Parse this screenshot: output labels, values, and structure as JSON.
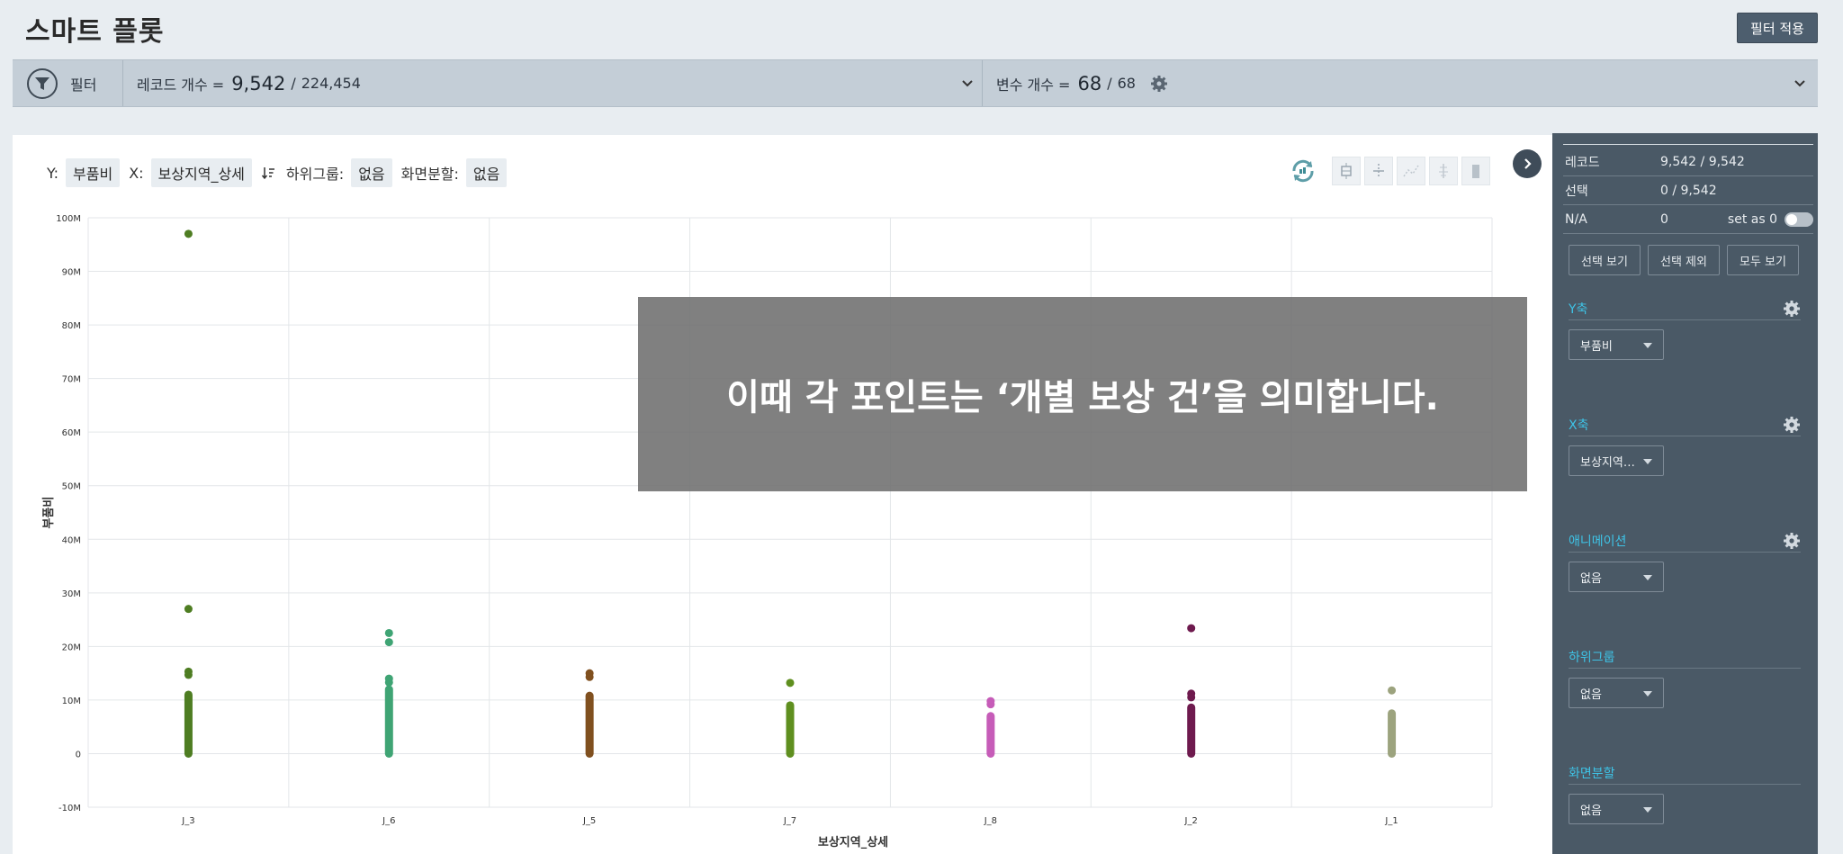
{
  "header": {
    "title": "스마트 플롯",
    "apply_button": "필터 적용"
  },
  "filterbar": {
    "filter_label": "필터",
    "records_label": "레코드 개수 =",
    "records_value": "9,542",
    "records_sep": "/",
    "records_total": "224,454",
    "vars_label": "변수 개수 =",
    "vars_value": "68",
    "vars_sep": "/",
    "vars_total": "68"
  },
  "controls": {
    "y_label": "Y:",
    "y_value": "부품비",
    "x_label": "X:",
    "x_value": "보상지역_상세",
    "subgroup_label": "하위그룹:",
    "subgroup_value": "없음",
    "split_label": "화면분할:",
    "split_value": "없음"
  },
  "overlay": {
    "caption": "이때 각 포인트는 ‘개별 보상 건’을 의미합니다."
  },
  "sidebar": {
    "stats": [
      {
        "key": "레코드",
        "value": "9,542 / 9,542"
      },
      {
        "key": "선택",
        "value": "0 / 9,542"
      },
      {
        "key": "N/A",
        "value": "0",
        "extra": "set as 0"
      }
    ],
    "buttons": [
      "선택 보기",
      "선택 제외",
      "모두 보기"
    ],
    "sections": [
      {
        "title": "Y축",
        "value": "부품비",
        "gear": true
      },
      {
        "title": "X축",
        "value": "보상지역…",
        "gear": true
      },
      {
        "title": "애니메이션",
        "value": "없음",
        "gear": true
      },
      {
        "title": "하위그룹",
        "value": "없음",
        "gear": false
      },
      {
        "title": "화면분할",
        "value": "없음",
        "gear": false
      }
    ]
  },
  "colors": {
    "J_3": "#4e7d22",
    "J_6": "#3fa474",
    "J_5": "#80501f",
    "J_7": "#5f8f1f",
    "J_8": "#c65cb8",
    "J_2": "#6e1a4e",
    "J_1": "#9ca37e"
  },
  "chart_data": {
    "type": "scatter",
    "xlabel": "보상지역_상세",
    "ylabel": "부품비",
    "categories": [
      "J_3",
      "J_6",
      "J_5",
      "J_7",
      "J_8",
      "J_2",
      "J_1"
    ],
    "ylim": [
      -10000000,
      100000000
    ],
    "yticks": [
      "-10M",
      "0",
      "10M",
      "20M",
      "30M",
      "40M",
      "50M",
      "60M",
      "70M",
      "80M",
      "90M",
      "100M"
    ],
    "grid": true,
    "series": [
      {
        "category": "J_3",
        "outliers": [
          97000000,
          27000000,
          15300000,
          14700000
        ],
        "range": [
          0,
          11000000
        ]
      },
      {
        "category": "J_6",
        "outliers": [
          22500000,
          20800000,
          14000000,
          13300000
        ],
        "range": [
          0,
          12000000
        ]
      },
      {
        "category": "J_5",
        "outliers": [
          15000000,
          14300000
        ],
        "range": [
          0,
          10800000
        ]
      },
      {
        "category": "J_7",
        "outliers": [
          13200000
        ],
        "range": [
          0,
          9000000
        ]
      },
      {
        "category": "J_8",
        "outliers": [
          9800000,
          9200000
        ],
        "range": [
          0,
          7000000
        ]
      },
      {
        "category": "J_2",
        "outliers": [
          23400000,
          11200000,
          10500000
        ],
        "range": [
          0,
          8600000
        ]
      },
      {
        "category": "J_1",
        "outliers": [
          11800000
        ],
        "range": [
          0,
          7500000
        ]
      }
    ]
  }
}
